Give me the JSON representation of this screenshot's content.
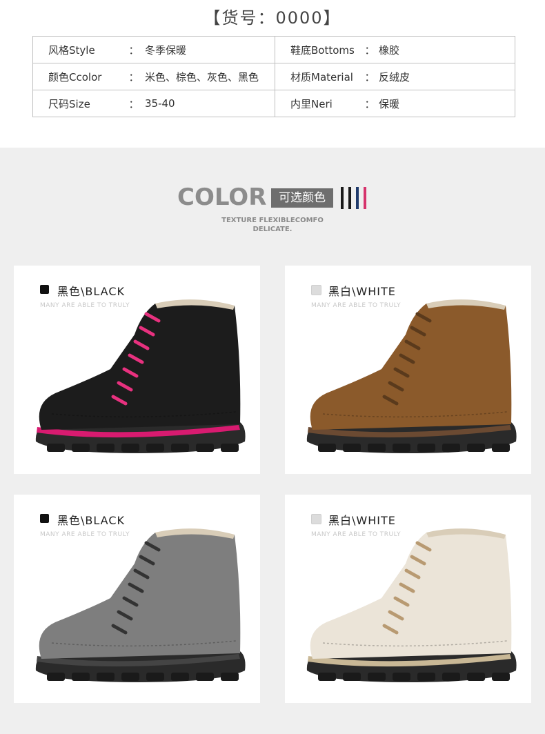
{
  "header": {
    "title": "【货号：0000】"
  },
  "spec": {
    "rows": [
      {
        "k1": "风格Style",
        "v1": "冬季保暖",
        "k2": "鞋底Bottoms",
        "v2": "橡胶"
      },
      {
        "k1": "颜色Ccolor",
        "v1": "米色、棕色、灰色、黑色",
        "k2": "材质Material",
        "v2": "反绒皮"
      },
      {
        "k1": "尺码Size",
        "v1": "35-40",
        "k2": "内里Neri",
        "v2": "保暖"
      }
    ],
    "colon": "："
  },
  "color_section": {
    "word": "COLOR",
    "badge": "可选颜色",
    "sub_line1": "TEXTURE FLEXIBLECOMFO",
    "sub_line2": "DELICATE.",
    "bar_colors": [
      "#1a1a1a",
      "#1a1a1a",
      "#1f3a6b",
      "#d6336c"
    ]
  },
  "cards": [
    {
      "label": "黑色\\BLACK",
      "tagline": "MANY ARE ABLE TO TRULY",
      "swatch": "#111111",
      "boot_color": "#1c1c1c",
      "lace_color": "#e8317f",
      "welt_color": "#d81b70",
      "icon": "black-boot-image"
    },
    {
      "label": "黑白\\WHITE",
      "tagline": "MANY ARE ABLE TO TRULY",
      "swatch": "#dcdcdc",
      "boot_color": "#8b5a2b",
      "lace_color": "#5a3a1c",
      "welt_color": "#6b4a32",
      "icon": "brown-boot-image"
    },
    {
      "label": "黑色\\BLACK",
      "tagline": "MANY ARE ABLE TO TRULY",
      "swatch": "#111111",
      "boot_color": "#7e7e7e",
      "lace_color": "#333333",
      "welt_color": "#444444",
      "icon": "gray-boot-image"
    },
    {
      "label": "黑白\\WHITE",
      "tagline": "MANY ARE ABLE TO TRULY",
      "swatch": "#dcdcdc",
      "boot_color": "#ebe4d8",
      "lace_color": "#b89a72",
      "welt_color": "#c9b896",
      "icon": "beige-boot-image"
    }
  ]
}
